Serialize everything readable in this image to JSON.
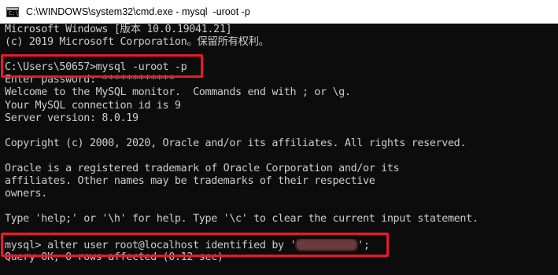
{
  "window": {
    "title": "C:\\WINDOWS\\system32\\cmd.exe - mysql  -uroot -p",
    "icon": "cmd-icon"
  },
  "console": {
    "lines": [
      "Microsoft Windows [版本 10.0.19041.21]",
      "(c) 2019 Microsoft Corporation。保留所有权利。",
      "",
      "C:\\Users\\50657>mysql -uroot -p",
      "Enter password: ************",
      "Welcome to the MySQL monitor.  Commands end with ; or \\g.",
      "Your MySQL connection id is 9",
      "Server version: 8.0.19",
      "",
      "Copyright (c) 2000, 2020, Oracle and/or its affiliates. All rights reserved.",
      "",
      "Oracle is a registered trademark of Oracle Corporation and/or its",
      "affiliates. Other names may be trademarks of their respective",
      "owners.",
      "",
      "Type 'help;' or '\\h' for help. Type '\\c' to clear the current input statement.",
      ""
    ],
    "sql_prefix": "mysql> alter user root@localhost identified by '",
    "sql_suffix": "';",
    "result": "Query OK, 0 rows affected (0.12 sec)"
  },
  "colors": {
    "console_bg": "#0c0c0c",
    "console_text": "#cccccc",
    "highlight": "#e8192c"
  }
}
